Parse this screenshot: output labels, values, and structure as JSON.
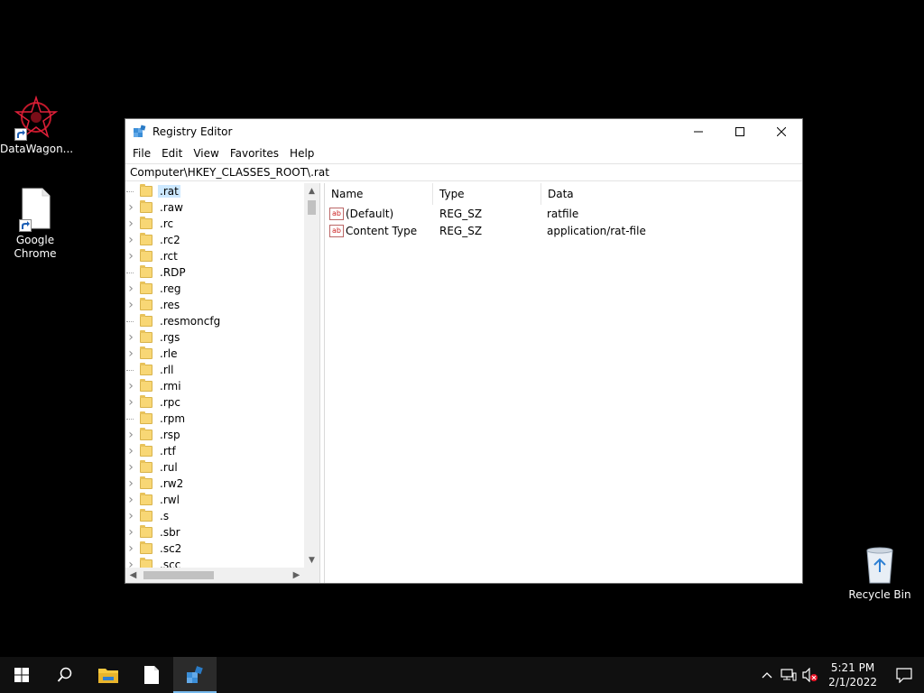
{
  "desktop": {
    "icons": [
      {
        "label": "DataWagon...",
        "icon": "datawagon-icon"
      },
      {
        "label": "Google Chrome",
        "icon": "document-icon"
      }
    ],
    "recycle_bin": {
      "label": "Recycle Bin",
      "icon": "recycle-bin-icon"
    }
  },
  "window": {
    "title": "Registry Editor",
    "menu": [
      "File",
      "Edit",
      "View",
      "Favorites",
      "Help"
    ],
    "address": "Computer\\HKEY_CLASSES_ROOT\\.rat",
    "tree": {
      "selected": ".rat",
      "items": [
        {
          "label": ".rat",
          "expandable": false
        },
        {
          "label": ".raw",
          "expandable": true
        },
        {
          "label": ".rc",
          "expandable": true
        },
        {
          "label": ".rc2",
          "expandable": true
        },
        {
          "label": ".rct",
          "expandable": true
        },
        {
          "label": ".RDP",
          "expandable": false
        },
        {
          "label": ".reg",
          "expandable": true
        },
        {
          "label": ".res",
          "expandable": true
        },
        {
          "label": ".resmoncfg",
          "expandable": false
        },
        {
          "label": ".rgs",
          "expandable": true
        },
        {
          "label": ".rle",
          "expandable": true
        },
        {
          "label": ".rll",
          "expandable": false
        },
        {
          "label": ".rmi",
          "expandable": true
        },
        {
          "label": ".rpc",
          "expandable": true
        },
        {
          "label": ".rpm",
          "expandable": false
        },
        {
          "label": ".rsp",
          "expandable": true
        },
        {
          "label": ".rtf",
          "expandable": true
        },
        {
          "label": ".rul",
          "expandable": true
        },
        {
          "label": ".rw2",
          "expandable": true
        },
        {
          "label": ".rwl",
          "expandable": true
        },
        {
          "label": ".s",
          "expandable": true
        },
        {
          "label": ".sbr",
          "expandable": true
        },
        {
          "label": ".sc2",
          "expandable": true
        },
        {
          "label": ".scc",
          "expandable": true
        }
      ]
    },
    "values": {
      "columns": [
        "Name",
        "Type",
        "Data"
      ],
      "rows": [
        {
          "name": "(Default)",
          "type": "REG_SZ",
          "data": "ratfile"
        },
        {
          "name": "Content Type",
          "type": "REG_SZ",
          "data": "application/rat-file"
        }
      ]
    }
  },
  "taskbar": {
    "buttons": [
      "windows-start-icon",
      "search-icon",
      "file-explorer-icon",
      "notepad-icon",
      "registry-editor-icon"
    ],
    "active": "registry-editor-icon",
    "tray": {
      "time": "5:21 PM",
      "date": "2/1/2022"
    }
  },
  "colors": {
    "desktop": "#000000",
    "taskbar": "#101010",
    "selection": "#cce8ff",
    "accent": "#76b9ed"
  }
}
